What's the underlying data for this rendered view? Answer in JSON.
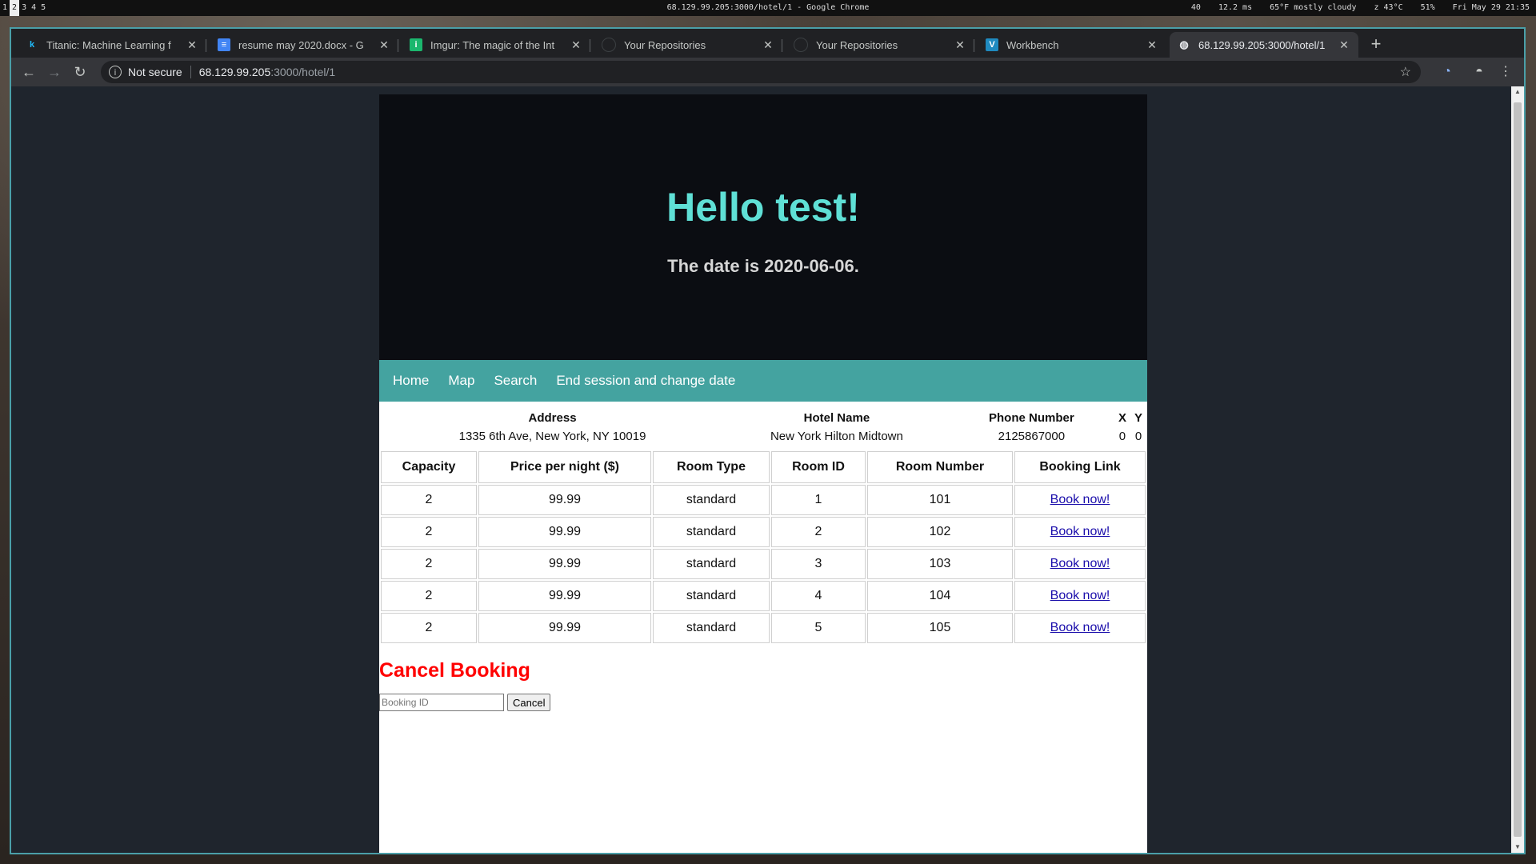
{
  "os_bar": {
    "workspaces": [
      "1",
      "2",
      "3",
      "4",
      "5"
    ],
    "active_workspace": "2",
    "window_title": "68.129.99.205:3000/hotel/1 - Google Chrome",
    "indicators": [
      "40",
      "12.2 ms",
      "65°F mostly cloudy",
      "z 43°C",
      "51%",
      "Fri May 29 21:35"
    ]
  },
  "browser": {
    "tabs": [
      {
        "title": "Titanic: Machine Learning f",
        "icon": "kaggle-icon"
      },
      {
        "title": "resume may 2020.docx - G",
        "icon": "google-docs-icon"
      },
      {
        "title": "Imgur: The magic of the Int",
        "icon": "imgur-icon"
      },
      {
        "title": "Your Repositories",
        "icon": "github-icon"
      },
      {
        "title": "Your Repositories",
        "icon": "github-icon"
      },
      {
        "title": "Workbench",
        "icon": "workbench-icon"
      },
      {
        "title": "68.129.99.205:3000/hotel/1",
        "icon": "globe-icon",
        "active": true
      }
    ],
    "address": {
      "security_label": "Not secure",
      "host": "68.129.99.205",
      "path": ":3000/hotel/1"
    }
  },
  "hero": {
    "greeting": "Hello test!",
    "date_text": "The date is 2020-06-06."
  },
  "nav": {
    "items": [
      "Home",
      "Map",
      "Search",
      "End session and change date"
    ]
  },
  "hotel": {
    "headers": [
      "Address",
      "Hotel Name",
      "Phone Number",
      "X",
      "Y"
    ],
    "values": [
      "1335 6th Ave, New York, NY 10019",
      "New York Hilton Midtown",
      "2125867000",
      "0",
      "0"
    ]
  },
  "rooms": {
    "headers": [
      "Capacity",
      "Price per night ($)",
      "Room Type",
      "Room ID",
      "Room Number",
      "Booking Link"
    ],
    "rows": [
      [
        "2",
        "99.99",
        "standard",
        "1",
        "101",
        "Book now!"
      ],
      [
        "2",
        "99.99",
        "standard",
        "2",
        "102",
        "Book now!"
      ],
      [
        "2",
        "99.99",
        "standard",
        "3",
        "103",
        "Book now!"
      ],
      [
        "2",
        "99.99",
        "standard",
        "4",
        "104",
        "Book now!"
      ],
      [
        "2",
        "99.99",
        "standard",
        "5",
        "105",
        "Book now!"
      ]
    ]
  },
  "cancel": {
    "title": "Cancel Booking",
    "placeholder": "Booking ID",
    "button_label": "Cancel"
  },
  "colors": {
    "hero_bg": "#0b0d12",
    "greeting": "#5fe0d6",
    "navbar": "#44a3a0",
    "cancel_title": "#ff0000",
    "link": "#1a0dab"
  }
}
